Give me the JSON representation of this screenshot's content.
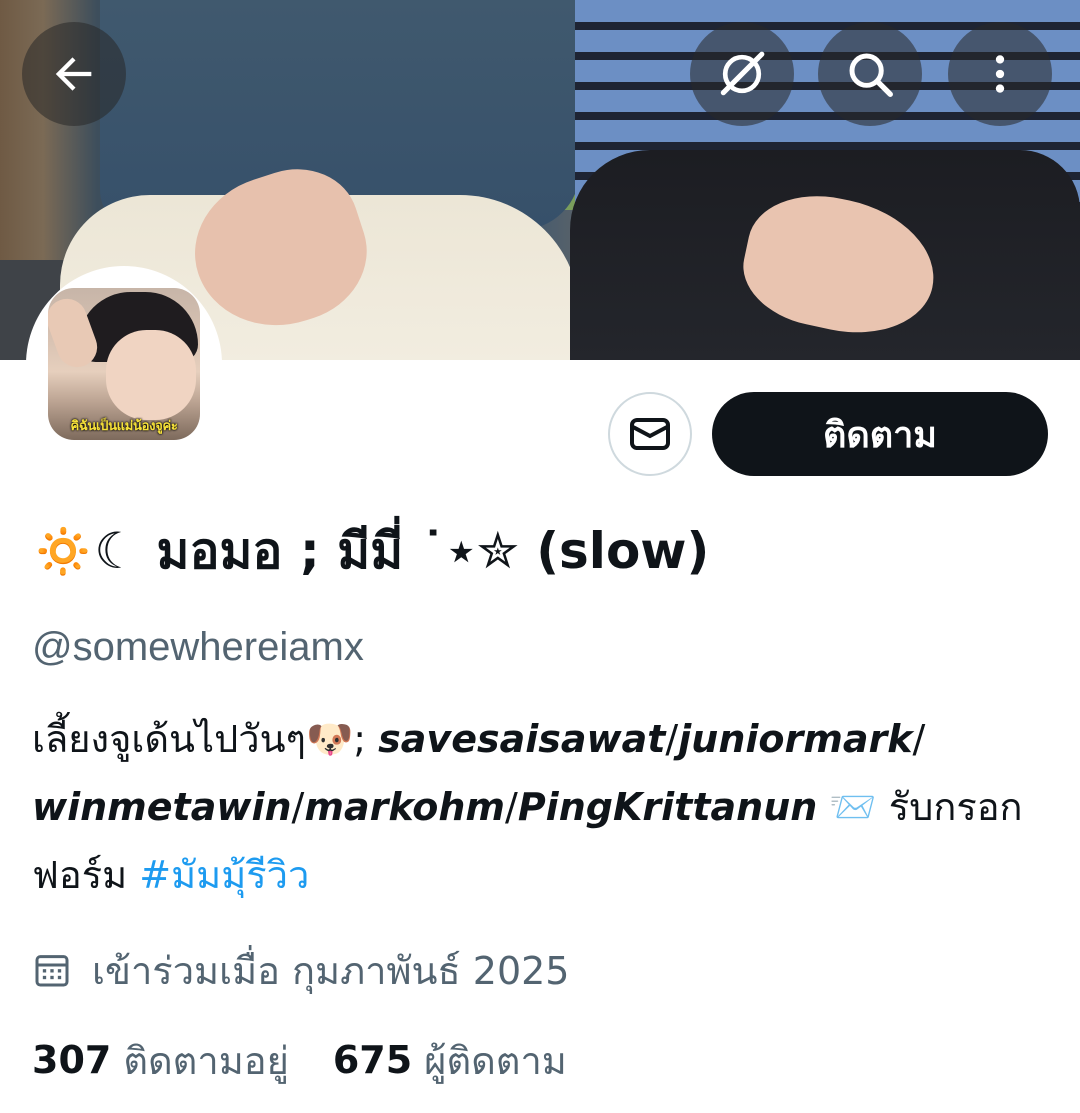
{
  "header": {
    "back_icon": "arrow-left-icon",
    "grok_icon": "grok-icon",
    "search_icon": "search-icon",
    "more_icon": "more-vertical-icon"
  },
  "profile": {
    "avatar_caption": "คิฉันเป็นแม่น้องจูค่ะ",
    "message_icon": "envelope-icon",
    "follow_label": "ติดตาม",
    "display_name": "🔅☾ มอมอ ; มีมี่ ˙⋆✮ (slow)",
    "handle": "@somewhereiamx",
    "bio": {
      "text_1": "เลี้ยงจูเด้นไปวันๆ🐶; ",
      "mentions": [
        "savesaisawat",
        "juniormark",
        "winmetawin",
        "markohm",
        "PingKrittanun"
      ],
      "separator": "/",
      "text_2": " 📨 รับกรอกฟอร์ม ",
      "hashtag": "#มัมมุ้รีวิว"
    },
    "joined_icon": "calendar-icon",
    "joined": "เข้าร่วมเมื่อ กุมภาพันธ์ 2025",
    "following_count": "307",
    "following_label": "ติดตามอยู่",
    "followers_count": "675",
    "followers_label": "ผู้ติดตาม"
  },
  "colors": {
    "text_primary": "#0f1419",
    "text_secondary": "#536471",
    "link": "#1d9bf0",
    "button_dark": "#0f1419",
    "border": "#cfd9de"
  }
}
